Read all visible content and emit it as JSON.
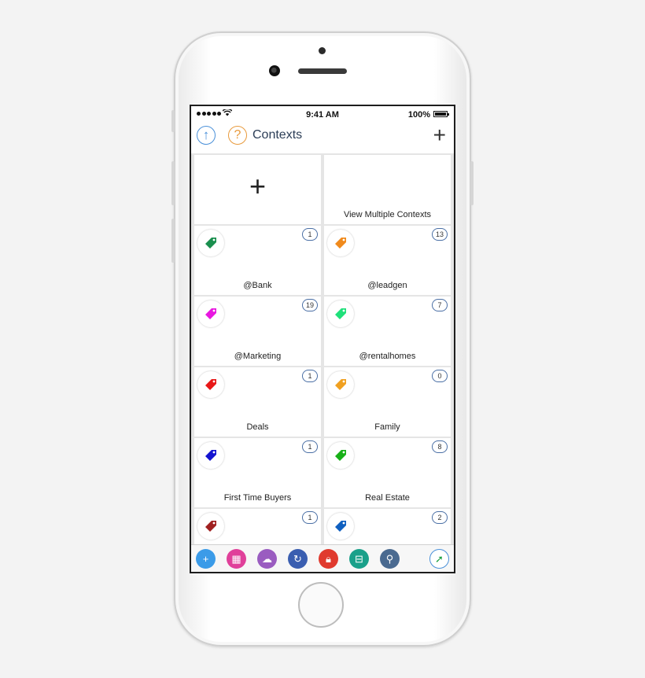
{
  "status_bar": {
    "time": "9:41 AM",
    "battery": "100%"
  },
  "nav": {
    "title": "Contexts",
    "up_icon": "arrow-up-icon",
    "help_icon": "question-icon",
    "add_label": "+"
  },
  "grid": {
    "add_tile_label": "+",
    "view_multiple_label": "View Multiple Contexts",
    "contexts": [
      {
        "name": "@Bank",
        "count": "1",
        "color": "#1a8f4e"
      },
      {
        "name": "@leadgen",
        "count": "13",
        "color": "#f08a1c"
      },
      {
        "name": "@Marketing",
        "count": "19",
        "color": "#e817e0"
      },
      {
        "name": "@rentalhomes",
        "count": "7",
        "color": "#1fe07a"
      },
      {
        "name": "Deals",
        "count": "1",
        "color": "#e81818"
      },
      {
        "name": "Family",
        "count": "0",
        "color": "#f0a020"
      },
      {
        "name": "First Time Buyers",
        "count": "1",
        "color": "#1414d0"
      },
      {
        "name": "Real Estate",
        "count": "8",
        "color": "#18b018"
      },
      {
        "name": "",
        "count": "1",
        "color": "#a02020"
      },
      {
        "name": "",
        "count": "2",
        "color": "#1060c0"
      }
    ]
  },
  "toolbar": {
    "items": [
      {
        "icon": "add-icon",
        "color": "#3b9be8"
      },
      {
        "icon": "calendar-grid-icon",
        "color": "#e0409a"
      },
      {
        "icon": "cloud-sync-icon",
        "color": "#9a5cc0"
      },
      {
        "icon": "refresh-icon",
        "color": "#3a5eb0"
      },
      {
        "icon": "lock-icon",
        "color": "#e03a2e"
      },
      {
        "icon": "cart-icon",
        "color": "#1aa08a"
      },
      {
        "icon": "search-icon",
        "color": "#4a6a90"
      },
      {
        "icon": "compass-icon",
        "color": "#ffffff"
      }
    ]
  }
}
